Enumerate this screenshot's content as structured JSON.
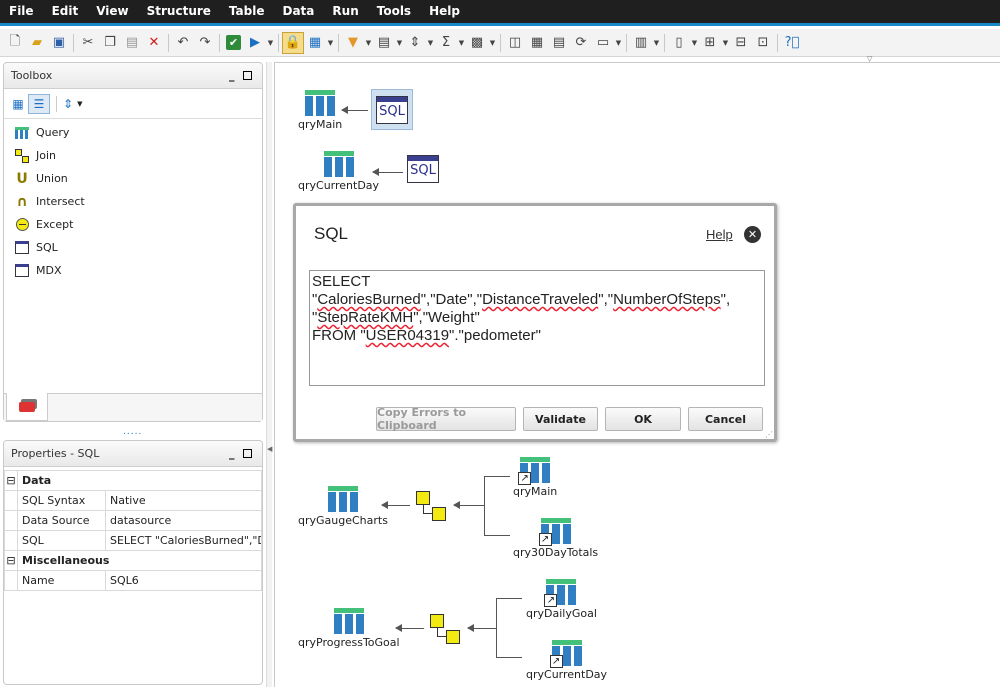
{
  "menu": [
    "File",
    "Edit",
    "View",
    "Structure",
    "Table",
    "Data",
    "Run",
    "Tools",
    "Help"
  ],
  "toolbox": {
    "title": "Toolbox",
    "items": [
      {
        "label": "Query",
        "icon": "query-icon"
      },
      {
        "label": "Join",
        "icon": "join-icon"
      },
      {
        "label": "Union",
        "icon": "union-icon"
      },
      {
        "label": "Intersect",
        "icon": "intersect-icon"
      },
      {
        "label": "Except",
        "icon": "except-icon"
      },
      {
        "label": "SQL",
        "icon": "sql-icon"
      },
      {
        "label": "MDX",
        "icon": "mdx-icon"
      }
    ]
  },
  "properties": {
    "title": "Properties -  SQL",
    "categories": [
      {
        "name": "Data",
        "rows": [
          {
            "key": "SQL Syntax",
            "value": "Native"
          },
          {
            "key": "Data Source",
            "value": "datasource"
          },
          {
            "key": "SQL",
            "value": "SELECT \"CaloriesBurned\",\"Da..."
          }
        ]
      },
      {
        "name": "Miscellaneous",
        "rows": [
          {
            "key": "Name",
            "value": "SQL6"
          }
        ]
      }
    ]
  },
  "diagram": {
    "qryMain": "qryMain",
    "qryCurrentDay": "qryCurrentDay",
    "sql_icon_label": "SQL",
    "gauge": {
      "target": "qryGaugeCharts",
      "src1": "qryMain",
      "src2": "qry30DayTotals"
    },
    "progress": {
      "target": "qryProgressToGoal",
      "src1": "qryDailyGoal",
      "src2": "qryCurrentDay"
    }
  },
  "dialog": {
    "title": "SQL",
    "help": "Help",
    "sql_lines": [
      "SELECT",
      "\"CaloriesBurned\",\"Date\",\"DistanceTraveled\",\"NumberOfSteps\",",
      "\"StepRateKMH\",\"Weight\"",
      "FROM \"USER04319\".\"pedometer\""
    ],
    "buttons": {
      "copy": "Copy Errors to Clipboard",
      "validate": "Validate",
      "ok": "OK",
      "cancel": "Cancel"
    }
  }
}
